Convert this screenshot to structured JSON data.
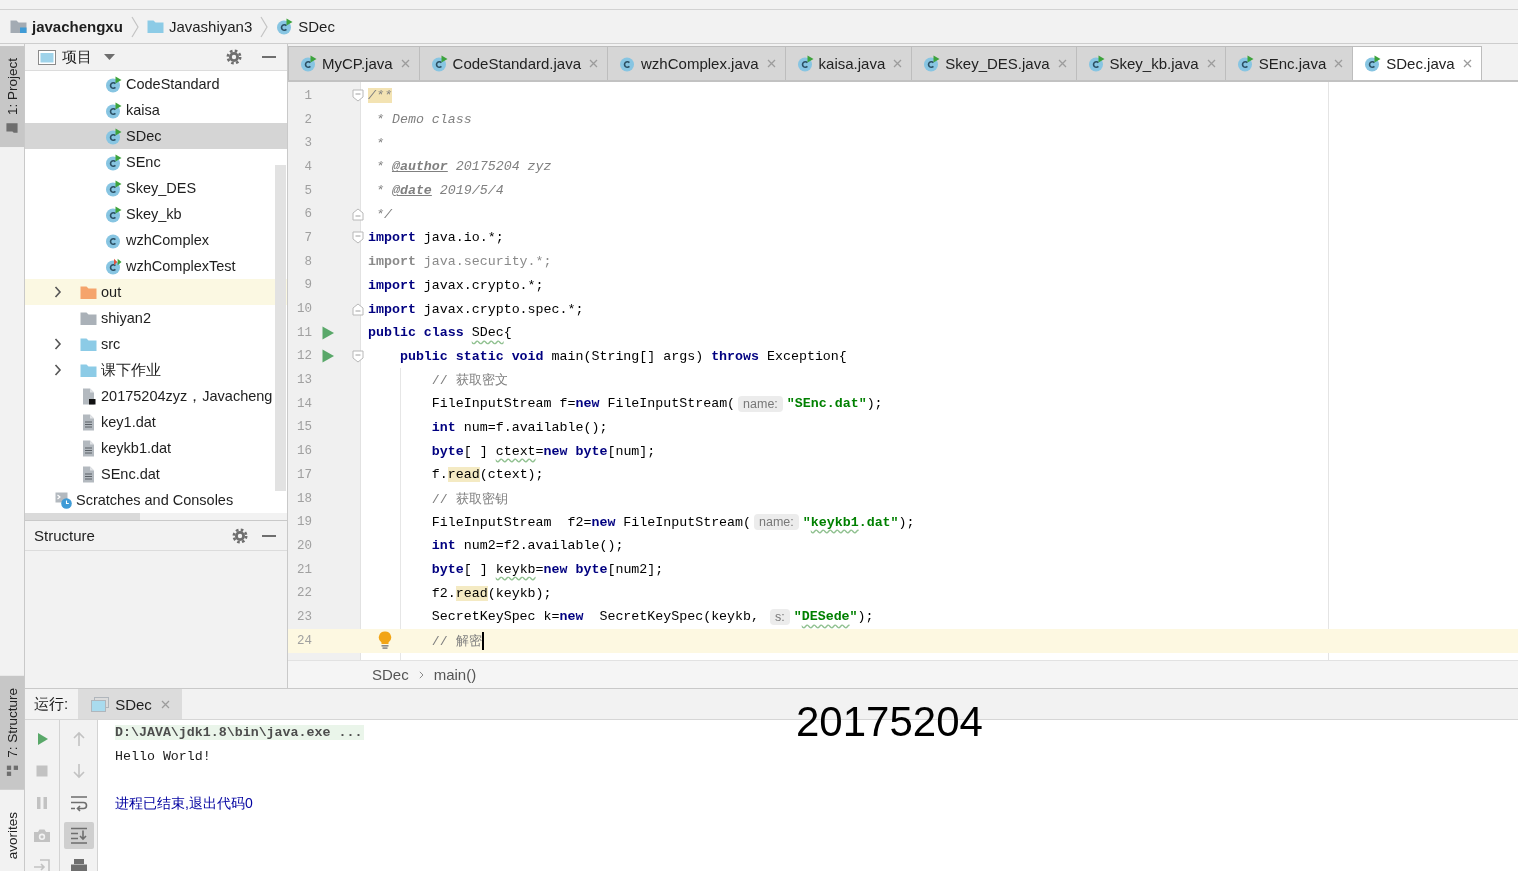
{
  "navigation_bar": {
    "items": [
      {
        "label": "javachengxu",
        "kind": "module"
      },
      {
        "label": "Javashiyan3",
        "kind": "source-folder"
      },
      {
        "label": "SDec",
        "kind": "runnable-class"
      }
    ]
  },
  "left_stripe": {
    "top": [
      {
        "label": "1: Project",
        "kind": "project",
        "selected": true
      }
    ],
    "bottom": [
      {
        "label": "7: Structure",
        "kind": "structure",
        "selected": true
      },
      {
        "label": "avorites",
        "kind": "favorites",
        "selected": false
      }
    ]
  },
  "project_panel": {
    "title": "项目",
    "tree": [
      {
        "children": [
          {
            "children": [
              {
                "label": "CodeStandard",
                "kind": "runnable-class",
                "selected": false
              },
              {
                "label": "kaisa",
                "kind": "runnable-class",
                "selected": false
              },
              {
                "label": "SDec",
                "kind": "runnable-class",
                "selected": true
              },
              {
                "label": "SEnc",
                "kind": "runnable-class",
                "selected": false
              },
              {
                "label": "Skey_DES",
                "kind": "runnable-class",
                "selected": false
              },
              {
                "label": "Skey_kb",
                "kind": "runnable-class",
                "selected": false
              },
              {
                "label": "wzhComplex",
                "kind": "class",
                "selected": false
              },
              {
                "label": "wzhComplexTest",
                "kind": "test-class",
                "selected": false
              }
            ]
          },
          {
            "label": "out",
            "kind": "excluded-folder",
            "expanded": false,
            "selected": false
          },
          {
            "label": "shiyan2",
            "kind": "folder",
            "selected": false
          },
          {
            "label": "src",
            "kind": "source-folder",
            "expanded": false,
            "selected": false
          },
          {
            "label": "课下作业",
            "kind": "source-folder",
            "expanded": false,
            "selected": false
          },
          {
            "label": "20175204zyz，Javacheng",
            "kind": "unknown-file",
            "selected": false
          },
          {
            "label": "key1.dat",
            "kind": "text-file",
            "selected": false
          },
          {
            "label": "keykb1.dat",
            "kind": "text-file",
            "selected": false
          },
          {
            "label": "SEnc.dat",
            "kind": "text-file",
            "selected": false
          }
        ]
      },
      {
        "label": "Scratches and Consoles",
        "kind": "scratches",
        "selected": false
      }
    ]
  },
  "structure_panel": {
    "title": "Structure"
  },
  "editor": {
    "tabs": [
      {
        "label": "MyCP.java",
        "kind": "runnable-class",
        "selected": false
      },
      {
        "label": "CodeStandard.java",
        "kind": "runnable-class",
        "selected": false
      },
      {
        "label": "wzhComplex.java",
        "kind": "class",
        "selected": false
      },
      {
        "label": "kaisa.java",
        "kind": "runnable-class",
        "selected": false
      },
      {
        "label": "Skey_DES.java",
        "kind": "runnable-class",
        "selected": false
      },
      {
        "label": "Skey_kb.java",
        "kind": "runnable-class",
        "selected": false
      },
      {
        "label": "SEnc.java",
        "kind": "runnable-class",
        "selected": false
      },
      {
        "label": "SDec.java",
        "kind": "runnable-class",
        "selected": true
      }
    ],
    "lines": [
      {
        "number": "1",
        "run": false,
        "fold_start": true,
        "fold_end": false,
        "bulb": false,
        "current": false,
        "segments": [
          {
            "text": "/**",
            "kind": "comment-marked"
          }
        ]
      },
      {
        "number": "2",
        "run": false,
        "fold_start": false,
        "fold_end": false,
        "bulb": false,
        "current": false,
        "segments": [
          {
            "text": " * Demo class",
            "kind": "comment"
          }
        ]
      },
      {
        "number": "3",
        "run": false,
        "fold_start": false,
        "fold_end": false,
        "bulb": false,
        "current": false,
        "segments": [
          {
            "text": " *",
            "kind": "comment"
          }
        ]
      },
      {
        "number": "4",
        "run": false,
        "fold_start": false,
        "fold_end": false,
        "bulb": false,
        "current": false,
        "segments": [
          {
            "text": " * ",
            "kind": "comment"
          },
          {
            "text": "@author",
            "kind": "doc-tag"
          },
          {
            "text": " 20175204 zyz",
            "kind": "comment"
          }
        ]
      },
      {
        "number": "5",
        "run": false,
        "fold_start": false,
        "fold_end": false,
        "bulb": false,
        "current": false,
        "segments": [
          {
            "text": " * ",
            "kind": "comment"
          },
          {
            "text": "@date",
            "kind": "doc-tag"
          },
          {
            "text": " 2019/5/4",
            "kind": "comment"
          }
        ]
      },
      {
        "number": "6",
        "run": false,
        "fold_start": false,
        "fold_end": true,
        "bulb": false,
        "current": false,
        "segments": [
          {
            "text": " */",
            "kind": "comment"
          }
        ]
      },
      {
        "number": "7",
        "run": false,
        "fold_start": true,
        "fold_end": false,
        "bulb": false,
        "current": false,
        "segments": [
          {
            "text": "import",
            "kind": "keyword"
          },
          {
            "text": " java.io.*;",
            "kind": "plain"
          }
        ]
      },
      {
        "number": "8",
        "run": false,
        "fold_start": false,
        "fold_end": false,
        "bulb": false,
        "current": false,
        "segments": [
          {
            "text": "import",
            "kind": "unused-keyword"
          },
          {
            "text": " java.security.*;",
            "kind": "unused"
          }
        ]
      },
      {
        "number": "9",
        "run": false,
        "fold_start": false,
        "fold_end": false,
        "bulb": false,
        "current": false,
        "segments": [
          {
            "text": "import",
            "kind": "keyword"
          },
          {
            "text": " javax.crypto.*;",
            "kind": "plain"
          }
        ]
      },
      {
        "number": "10",
        "run": false,
        "fold_start": false,
        "fold_end": true,
        "bulb": false,
        "current": false,
        "segments": [
          {
            "text": "import",
            "kind": "keyword"
          },
          {
            "text": " javax.crypto.spec.*;",
            "kind": "plain"
          }
        ]
      },
      {
        "number": "11",
        "run": true,
        "fold_start": false,
        "fold_end": false,
        "bulb": false,
        "current": false,
        "segments": [
          {
            "text": "public class ",
            "kind": "keyword"
          },
          {
            "text": "SDec",
            "kind": "typo"
          },
          {
            "text": "{",
            "kind": "plain"
          }
        ]
      },
      {
        "number": "12",
        "run": true,
        "fold_start": true,
        "fold_end": false,
        "bulb": false,
        "current": false,
        "segments": [
          {
            "text": "    public static void",
            "kind": "keyword"
          },
          {
            "text": " main(String[] args) ",
            "kind": "plain"
          },
          {
            "text": "throws",
            "kind": "keyword"
          },
          {
            "text": " Exception{",
            "kind": "plain"
          }
        ]
      },
      {
        "number": "13",
        "run": false,
        "fold_start": false,
        "fold_end": false,
        "bulb": false,
        "current": false,
        "segments": [
          {
            "text": "        // 获取密文",
            "kind": "line-comment"
          }
        ]
      },
      {
        "number": "14",
        "run": false,
        "fold_start": false,
        "fold_end": false,
        "bulb": false,
        "current": false,
        "segments": [
          {
            "text": "        FileInputStream f=",
            "kind": "plain"
          },
          {
            "text": "new",
            "kind": "keyword"
          },
          {
            "text": " FileInputStream(",
            "kind": "plain"
          },
          {
            "text": "name:",
            "kind": "hint"
          },
          {
            "text": "\"SEnc.dat\"",
            "kind": "string"
          },
          {
            "text": ");",
            "kind": "plain"
          }
        ]
      },
      {
        "number": "15",
        "run": false,
        "fold_start": false,
        "fold_end": false,
        "bulb": false,
        "current": false,
        "segments": [
          {
            "text": "        int",
            "kind": "keyword"
          },
          {
            "text": " num=f.available();",
            "kind": "plain"
          }
        ]
      },
      {
        "number": "16",
        "run": false,
        "fold_start": false,
        "fold_end": false,
        "bulb": false,
        "current": false,
        "segments": [
          {
            "text": "        byte",
            "kind": "keyword"
          },
          {
            "text": "[ ] ",
            "kind": "plain"
          },
          {
            "text": "ctext",
            "kind": "typo"
          },
          {
            "text": "=",
            "kind": "plain"
          },
          {
            "text": "new byte",
            "kind": "keyword"
          },
          {
            "text": "[num];",
            "kind": "plain"
          }
        ]
      },
      {
        "number": "17",
        "run": false,
        "fold_start": false,
        "fold_end": false,
        "bulb": false,
        "current": false,
        "segments": [
          {
            "text": "        f.",
            "kind": "plain"
          },
          {
            "text": "read",
            "kind": "usage"
          },
          {
            "text": "(ctext);",
            "kind": "plain"
          }
        ]
      },
      {
        "number": "18",
        "run": false,
        "fold_start": false,
        "fold_end": false,
        "bulb": false,
        "current": false,
        "segments": [
          {
            "text": "        // 获取密钥",
            "kind": "line-comment"
          }
        ]
      },
      {
        "number": "19",
        "run": false,
        "fold_start": false,
        "fold_end": false,
        "bulb": false,
        "current": false,
        "segments": [
          {
            "text": "        FileInputStream  f2=",
            "kind": "plain"
          },
          {
            "text": "new",
            "kind": "keyword"
          },
          {
            "text": " FileInputStream(",
            "kind": "plain"
          },
          {
            "text": "name:",
            "kind": "hint"
          },
          {
            "text": "\"",
            "kind": "string"
          },
          {
            "text": "keykb1",
            "kind": "string-typo"
          },
          {
            "text": ".dat\"",
            "kind": "string"
          },
          {
            "text": ");",
            "kind": "plain"
          }
        ]
      },
      {
        "number": "20",
        "run": false,
        "fold_start": false,
        "fold_end": false,
        "bulb": false,
        "current": false,
        "segments": [
          {
            "text": "        int",
            "kind": "keyword"
          },
          {
            "text": " num2=f2.available();",
            "kind": "plain"
          }
        ]
      },
      {
        "number": "21",
        "run": false,
        "fold_start": false,
        "fold_end": false,
        "bulb": false,
        "current": false,
        "segments": [
          {
            "text": "        byte",
            "kind": "keyword"
          },
          {
            "text": "[ ] ",
            "kind": "plain"
          },
          {
            "text": "keykb",
            "kind": "typo"
          },
          {
            "text": "=",
            "kind": "plain"
          },
          {
            "text": "new byte",
            "kind": "keyword"
          },
          {
            "text": "[num2];",
            "kind": "plain"
          }
        ]
      },
      {
        "number": "22",
        "run": false,
        "fold_start": false,
        "fold_end": false,
        "bulb": false,
        "current": false,
        "segments": [
          {
            "text": "        f2.",
            "kind": "plain"
          },
          {
            "text": "read",
            "kind": "usage"
          },
          {
            "text": "(keykb);",
            "kind": "plain"
          }
        ]
      },
      {
        "number": "23",
        "run": false,
        "fold_start": false,
        "fold_end": false,
        "bulb": false,
        "current": false,
        "segments": [
          {
            "text": "        SecretKeySpec k=",
            "kind": "plain"
          },
          {
            "text": "new",
            "kind": "keyword"
          },
          {
            "text": "  SecretKeySpec(keykb, ",
            "kind": "plain"
          },
          {
            "text": "s:",
            "kind": "hint"
          },
          {
            "text": "\"",
            "kind": "string"
          },
          {
            "text": "DESede",
            "kind": "string-typo"
          },
          {
            "text": "\"",
            "kind": "string"
          },
          {
            "text": ");",
            "kind": "plain"
          }
        ]
      },
      {
        "number": "24",
        "run": false,
        "fold_start": false,
        "fold_end": false,
        "bulb": true,
        "current": true,
        "segments": [
          {
            "text": "        // 解密",
            "kind": "line-comment"
          }
        ]
      }
    ],
    "breadcrumbs": [
      {
        "label": "SDec"
      },
      {
        "label": "main()"
      }
    ]
  },
  "run_panel": {
    "label": "运行:",
    "tabs": [
      {
        "label": "SDec",
        "selected": true
      }
    ],
    "toolbar_left": [
      {
        "kind": "run",
        "disabled": false
      },
      {
        "kind": "stop",
        "disabled": true
      },
      {
        "kind": "pause",
        "disabled": true
      },
      {
        "kind": "camera",
        "disabled": true
      },
      {
        "kind": "exit",
        "disabled": true
      }
    ],
    "toolbar_right": [
      {
        "kind": "up",
        "disabled": true,
        "selected": false
      },
      {
        "kind": "down",
        "disabled": true,
        "selected": false
      },
      {
        "kind": "wrap",
        "disabled": false,
        "selected": false
      },
      {
        "kind": "scroll-end",
        "disabled": false,
        "selected": true
      },
      {
        "kind": "print",
        "disabled": false,
        "selected": false
      }
    ],
    "console": [
      {
        "text": "D:\\JAVA\\jdk1.8\\bin\\java.exe ...",
        "kind": "command"
      },
      {
        "text": "Hello World!",
        "kind": "output"
      },
      {
        "text": "进程已结束,退出代码0",
        "kind": "exit-status"
      }
    ]
  },
  "overlay_text": "20175204"
}
